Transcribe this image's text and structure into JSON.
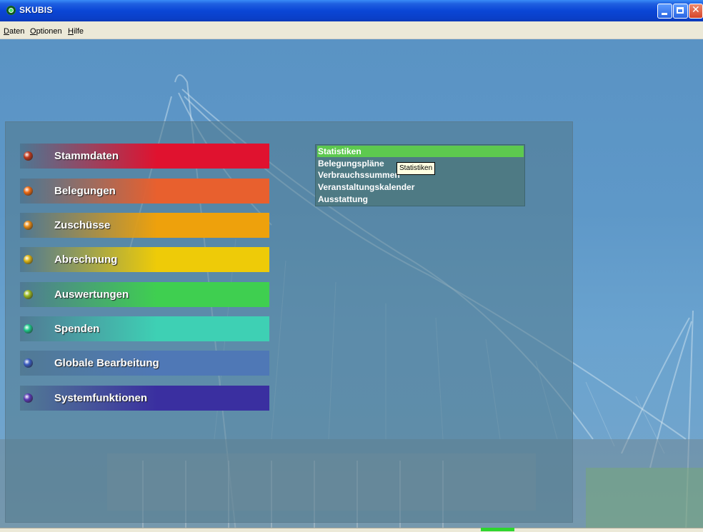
{
  "window": {
    "title": "SKUBIS"
  },
  "menubar": {
    "items": [
      {
        "label": "Daten",
        "accel": "D"
      },
      {
        "label": "Optionen",
        "accel": "O"
      },
      {
        "label": "Hilfe",
        "accel": "H"
      }
    ]
  },
  "nav": {
    "items": [
      {
        "label": "Stammdaten",
        "color": "#e0122f",
        "bullet": "#c0381c"
      },
      {
        "label": "Belegungen",
        "color": "#e8602e",
        "bullet": "#ee6a12"
      },
      {
        "label": "Zuschüsse",
        "color": "#eea10c",
        "bullet": "#e88a14"
      },
      {
        "label": "Abrechnung",
        "color": "#eecb08",
        "bullet": "#dcb414"
      },
      {
        "label": "Auswertungen",
        "color": "#3fcf50",
        "bullet": "#9ab820"
      },
      {
        "label": "Spenden",
        "color": "#3ed0b4",
        "bullet": "#1ec88a"
      },
      {
        "label": "Globale Bearbeitung",
        "color": "#4f78b6",
        "bullet": "#3a5cc0"
      },
      {
        "label": "Systemfunktionen",
        "color": "#3a2fa0",
        "bullet": "#5a38b4"
      }
    ]
  },
  "submenu": {
    "items": [
      {
        "label": "Statistiken",
        "active": true
      },
      {
        "label": "Belegungspläne",
        "active": false
      },
      {
        "label": "Verbrauchssummen",
        "active": false
      },
      {
        "label": "Veranstaltungskalender",
        "active": false
      },
      {
        "label": "Ausstattung",
        "active": false
      }
    ]
  },
  "tooltip": {
    "text": "Statistiken"
  }
}
